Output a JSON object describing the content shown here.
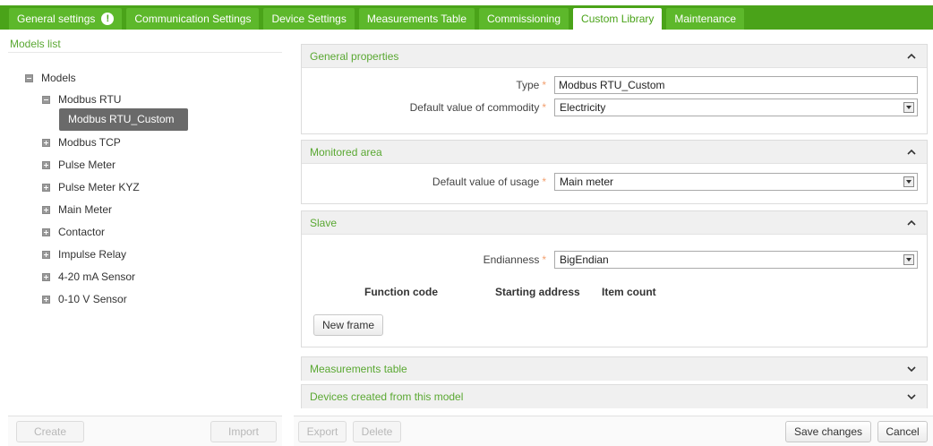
{
  "tabs": [
    {
      "label": "General settings",
      "warning": "!"
    },
    {
      "label": "Communication Settings"
    },
    {
      "label": "Device Settings"
    },
    {
      "label": "Measurements Table"
    },
    {
      "label": "Commissioning"
    },
    {
      "label": "Custom Library"
    },
    {
      "label": "Maintenance"
    }
  ],
  "active_tab": "Custom Library",
  "left": {
    "header": "Models list",
    "tree": {
      "root": "Models",
      "modbus_rtu": "Modbus RTU",
      "selected_child": "Modbus RTU_Custom",
      "items": [
        "Modbus TCP",
        "Pulse Meter",
        "Pulse Meter KYZ",
        "Main Meter",
        "Contactor",
        "Impulse Relay",
        "4-20 mA Sensor",
        "0-10 V Sensor"
      ]
    },
    "create_label": "Create",
    "import_label": "Import"
  },
  "sections": {
    "general": {
      "title": "General properties",
      "type_label": "Type",
      "type_value": "Modbus RTU_Custom",
      "commodity_label": "Default value of commodity",
      "commodity_value": "Electricity"
    },
    "monitored": {
      "title": "Monitored area",
      "usage_label": "Default value of usage",
      "usage_value": "Main meter"
    },
    "slave": {
      "title": "Slave",
      "endianness_label": "Endianness",
      "endianness_value": "BigEndian",
      "col_function": "Function code",
      "col_start": "Starting address",
      "col_count": "Item count",
      "new_frame_label": "New frame"
    },
    "measurements": {
      "title": "Measurements table"
    },
    "devices": {
      "title": "Devices created from this model"
    }
  },
  "footer": {
    "export_label": "Export",
    "delete_label": "Delete",
    "save_label": "Save changes",
    "cancel_label": "Cancel"
  },
  "required_marker": "*",
  "colors": {
    "brand_green": "#4aa319",
    "section_title": "#5aa832",
    "required": "#f3a070"
  }
}
